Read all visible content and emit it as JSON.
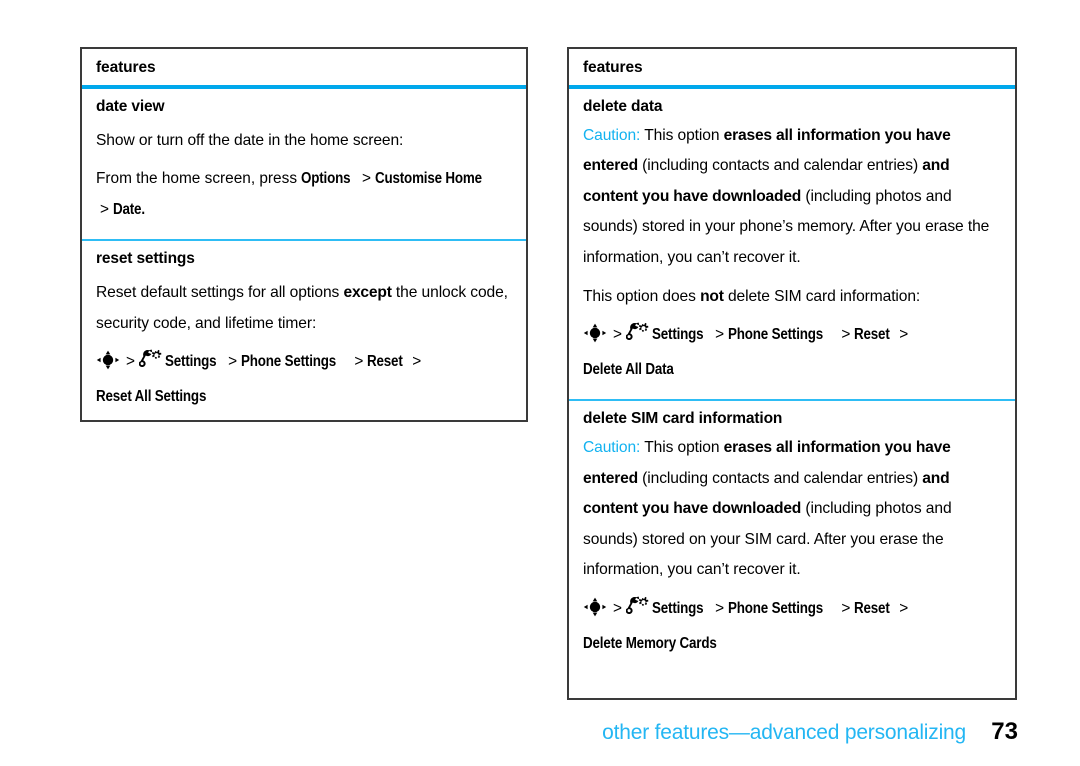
{
  "page": {
    "footer_title": "other features—advanced personalizing",
    "page_number": "73",
    "accent_cyan": "#00a8ec",
    "caution_color": "#13b2f0",
    "footer_color": "#23b6f3",
    "border_color": "#3a3a3a"
  },
  "left_column": {
    "header": "features",
    "sections": [
      {
        "title": "date view",
        "paragraphs": [
          {
            "text": "Show or turn off the date in the home screen:"
          }
        ],
        "instruction": {
          "lead": "From the home screen, press",
          "items": [
            "Options",
            "Customise Home",
            "Date."
          ]
        }
      },
      {
        "title": "reset settings",
        "paragraphs": [
          {
            "pre": "Reset default settings for all options ",
            "bold": "except",
            "post": " the unlock code, security code, and lifetime timer:"
          }
        ],
        "menupath": {
          "start_icon": "nav-key-icon",
          "settings_icon": "settings-wrench-gear-icon",
          "items": [
            "Settings",
            "Phone Settings",
            "Reset",
            "Reset All Settings"
          ]
        }
      }
    ]
  },
  "right_column": {
    "header": "features",
    "sections": [
      {
        "title": "delete data",
        "caution_label": "Caution:",
        "caution_body_1": " This option ",
        "caution_bold_1": "erases all information you have entered",
        "caution_body_2": " (including contacts and calendar entries) ",
        "caution_bold_2": "and content you have downloaded",
        "caution_body_3": " (including photos and sounds) stored in your phone’s memory. After you erase the information, you can’t recover it.",
        "note_pre": "This option does ",
        "note_bold": "not",
        "note_post": " delete SIM card information:",
        "menupath": {
          "start_icon": "nav-key-icon",
          "settings_icon": "settings-wrench-gear-icon",
          "items": [
            "Settings",
            "Phone Settings",
            "Reset",
            "Delete All Data"
          ]
        }
      },
      {
        "title": "delete SIM card information",
        "caution_label": "Caution:",
        "caution_body_1": " This option ",
        "caution_bold_1": "erases all information you have entered",
        "caution_body_2": " (including contacts and calendar entries) ",
        "caution_bold_2": "and content you have downloaded",
        "caution_body_3": " (including photos and sounds) stored on your SIM card. After you erase the information, you can’t recover it.",
        "menupath": {
          "start_icon": "nav-key-icon",
          "settings_icon": "settings-wrench-gear-icon",
          "items": [
            "Settings",
            "Phone Settings",
            "Reset",
            "Delete Memory Cards"
          ]
        }
      }
    ]
  },
  "icons": {
    "nav_key": "nav-key-icon",
    "settings": "settings-wrench-gear-icon",
    "chevron": ">"
  }
}
